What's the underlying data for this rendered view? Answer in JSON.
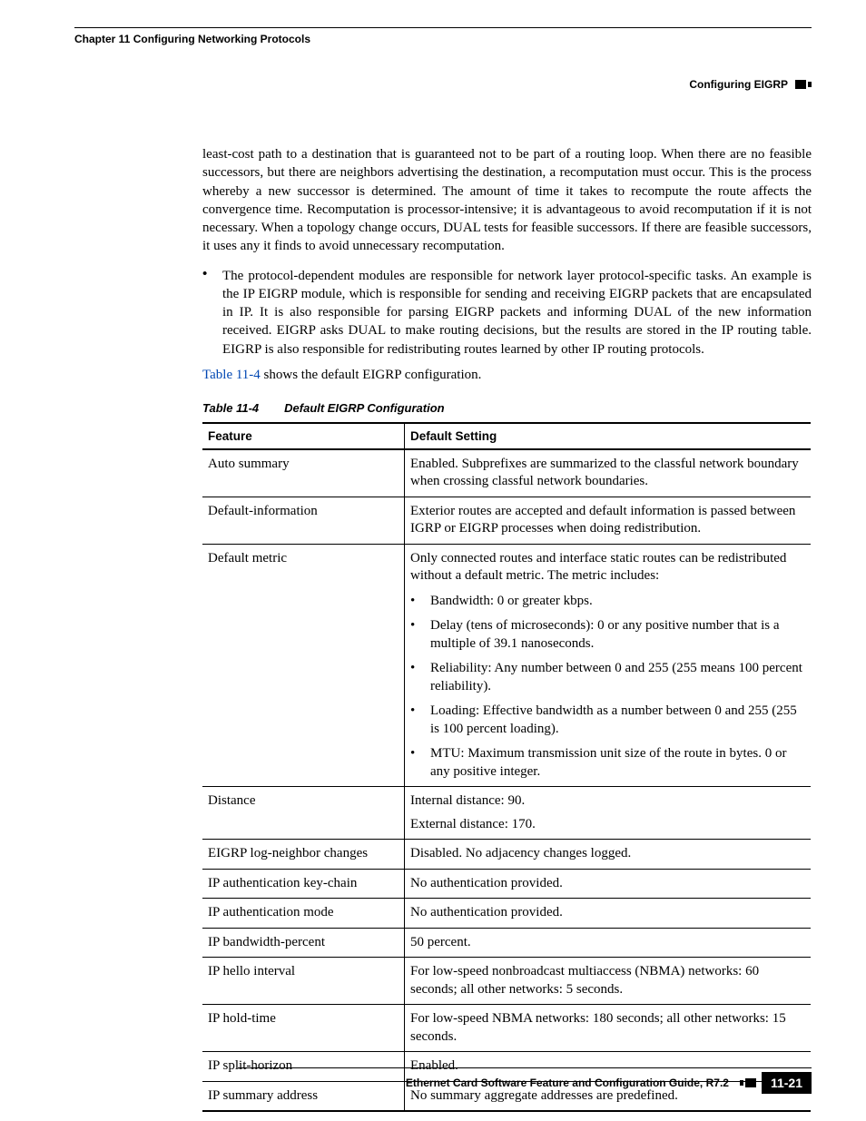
{
  "header": {
    "chapter": "Chapter 11 Configuring Networking Protocols",
    "section": "Configuring EIGRP"
  },
  "paragraphs": {
    "cont": "least-cost path to a destination that is guaranteed not to be part of a routing loop. When there are no feasible successors, but there are neighbors advertising the destination, a recomputation must occur. This is the process whereby a new successor is determined. The amount of time it takes to recompute the route affects the convergence time. Recomputation is processor-intensive; it is advantageous to avoid recomputation if it is not necessary. When a topology change occurs, DUAL tests for feasible successors. If there are feasible successors, it uses any it finds to avoid unnecessary recomputation.",
    "bullet": "The protocol-dependent modules are responsible for network layer protocol-specific tasks. An example is the IP EIGRP module, which is responsible for sending and receiving EIGRP packets that are encapsulated in IP. It is also responsible for parsing EIGRP packets and informing DUAL of the new information received. EIGRP asks DUAL to make routing decisions, but the results are stored in the IP routing table. EIGRP is also responsible for redistributing routes learned by other IP routing protocols."
  },
  "ref": {
    "link": "Table 11-4",
    "rest": " shows the default EIGRP configuration."
  },
  "table": {
    "number": "Table 11-4",
    "title": "Default EIGRP Configuration",
    "headers": {
      "c1": "Feature",
      "c2": "Default Setting"
    },
    "rows": {
      "r0": {
        "feature": "Auto summary",
        "setting": "Enabled. Subprefixes are summarized to the classful network boundary when crossing classful network boundaries."
      },
      "r1": {
        "feature": "Default-information",
        "setting": "Exterior routes are accepted and default information is passed between IGRP or EIGRP processes when doing redistribution."
      },
      "r2": {
        "feature": "Default metric",
        "intro": "Only connected routes and interface static routes can be redistributed without a default metric. The metric includes:",
        "items": {
          "i0": "Bandwidth: 0 or greater kbps.",
          "i1": "Delay (tens of microseconds): 0 or any positive number that is a multiple of 39.1 nanoseconds.",
          "i2": "Reliability: Any number between 0 and 255 (255 means 100 percent reliability).",
          "i3": "Loading: Effective bandwidth as a number between 0 and 255 (255 is 100 percent loading).",
          "i4": "MTU: Maximum transmission unit size of the route in bytes. 0 or any positive integer."
        }
      },
      "r3": {
        "feature": "Distance",
        "line1": "Internal distance: 90.",
        "line2": "External distance: 170."
      },
      "r4": {
        "feature": "EIGRP log-neighbor changes",
        "setting": "Disabled. No adjacency changes logged."
      },
      "r5": {
        "feature": "IP authentication key-chain",
        "setting": "No authentication provided."
      },
      "r6": {
        "feature": "IP authentication mode",
        "setting": "No authentication provided."
      },
      "r7": {
        "feature": "IP bandwidth-percent",
        "setting": "50 percent."
      },
      "r8": {
        "feature": "IP hello interval",
        "setting": "For low-speed nonbroadcast multiaccess (NBMA) networks: 60 seconds; all other networks: 5 seconds."
      },
      "r9": {
        "feature": "IP hold-time",
        "setting": "For low-speed NBMA networks: 180 seconds; all other networks: 15 seconds."
      },
      "r10": {
        "feature": "IP split-horizon",
        "setting": "Enabled."
      },
      "r11": {
        "feature": "IP summary address",
        "setting": "No summary aggregate addresses are predefined."
      }
    }
  },
  "footer": {
    "title": "Ethernet Card Software Feature and Configuration Guide, R7.2",
    "page": "11-21"
  }
}
